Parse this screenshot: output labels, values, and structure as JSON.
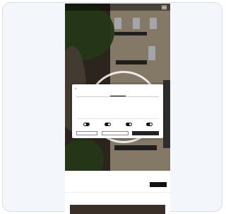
{
  "header": {
    "logo_text": "",
    "language": ""
  },
  "hero": {
    "vertical_text": ""
  },
  "cookie_banner": {
    "brand": "",
    "tabs": [
      "",
      "",
      ""
    ],
    "title": "",
    "body": "",
    "toggles": [
      {
        "label": "",
        "on": false
      },
      {
        "label": "",
        "on": true
      },
      {
        "label": "",
        "on": true
      },
      {
        "label": "",
        "on": true
      }
    ],
    "buttons": [
      "",
      "",
      ""
    ]
  },
  "booking": {
    "fields": [
      {
        "label": "",
        "value": ""
      },
      {
        "label": "",
        "value": ""
      },
      {
        "label": "",
        "value": ""
      },
      {
        "label": "",
        "value": ""
      }
    ],
    "button": ""
  },
  "section": {
    "title": "",
    "subtitle": ""
  },
  "colors": {
    "accent": "#111111",
    "card_background": "#f3f6fa"
  }
}
